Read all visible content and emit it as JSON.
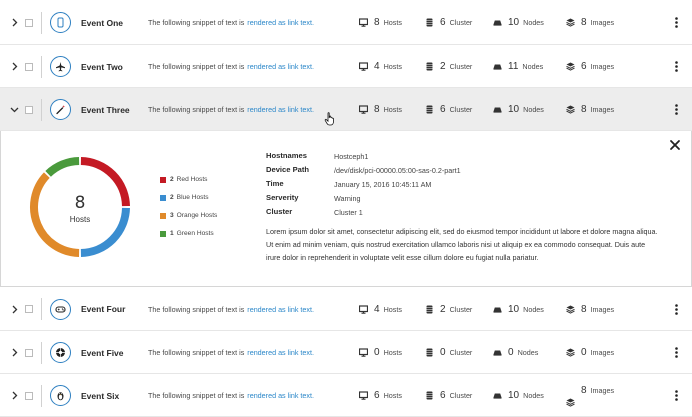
{
  "events": [
    {
      "name": "Event One",
      "icon": "server-icon",
      "desc_text": "The following snippet of text is",
      "desc_link": "rendered as link text.",
      "hosts": "8",
      "hosts_label": "Hosts",
      "cluster": "6",
      "cluster_label": "Cluster",
      "nodes": "10",
      "nodes_label": "Nodes",
      "images": "8",
      "images_label": "Images",
      "expanded": false
    },
    {
      "name": "Event Two",
      "icon": "airplane-icon",
      "desc_text": "The following snippet of text is",
      "desc_link": "rendered as link text.",
      "hosts": "4",
      "hosts_label": "Hosts",
      "cluster": "2",
      "cluster_label": "Cluster",
      "nodes": "11",
      "nodes_label": "Nodes",
      "images": "6",
      "images_label": "Images",
      "expanded": false
    },
    {
      "name": "Event Three",
      "icon": "magic-wand-icon",
      "desc_text": "The following snippet of text is",
      "desc_link": "rendered as link text.",
      "hosts": "8",
      "hosts_label": "Hosts",
      "cluster": "6",
      "cluster_label": "Cluster",
      "nodes": "10",
      "nodes_label": "Nodes",
      "images": "8",
      "images_label": "Images",
      "expanded": true
    },
    {
      "name": "Event Four",
      "icon": "gamepad-icon",
      "desc_text": "The following snippet of text is",
      "desc_link": "rendered as link text.",
      "hosts": "4",
      "hosts_label": "Hosts",
      "cluster": "2",
      "cluster_label": "Cluster",
      "nodes": "10",
      "nodes_label": "Nodes",
      "images": "8",
      "images_label": "Images",
      "expanded": false
    },
    {
      "name": "Event Five",
      "icon": "empire-icon",
      "desc_text": "The following snippet of text is",
      "desc_link": "rendered as link text.",
      "hosts": "0",
      "hosts_label": "Hosts",
      "cluster": "0",
      "cluster_label": "Cluster",
      "nodes": "0",
      "nodes_label": "Nodes",
      "images": "0",
      "images_label": "Images",
      "expanded": false
    },
    {
      "name": "Event Six",
      "icon": "linux-icon",
      "desc_text": "The following snippet of text is",
      "desc_link": "rendered as link text.",
      "hosts": "6",
      "hosts_label": "Hosts",
      "cluster": "6",
      "cluster_label": "Cluster",
      "nodes": "10",
      "nodes_label": "Nodes",
      "images": "8",
      "images_label": "Images",
      "expanded": false
    }
  ],
  "detail": {
    "donut": {
      "total": "8",
      "label": "Hosts",
      "segments": [
        {
          "count": "2",
          "name": "Red Hosts",
          "value": 2,
          "color": "#c41a24"
        },
        {
          "count": "2",
          "name": "Blue Hosts",
          "value": 2,
          "color": "#3a8dd0"
        },
        {
          "count": "3",
          "name": "Orange Hosts",
          "value": 3,
          "color": "#e08a2a"
        },
        {
          "count": "1",
          "name": "Green Hosts",
          "value": 1,
          "color": "#4a9a3c"
        }
      ]
    },
    "fields": [
      {
        "key": "Hostnames",
        "value": "Hostceph1"
      },
      {
        "key": "Device Path",
        "value": "/dev/disk/pci-00000.05:00-sas-0.2-part1"
      },
      {
        "key": "Time",
        "value": "January 15, 2016 10:45:11 AM"
      },
      {
        "key": "Serverity",
        "value": "Warning"
      },
      {
        "key": "Cluster",
        "value": "Cluster 1"
      }
    ],
    "description": "Lorem ipsum dolor sit amet, consectetur adipiscing elit, sed do eiusmod tempor incididunt ut labore et dolore magna aliqua. Ut enim ad minim veniam, quis nostrud exercitation ullamco laboris nisi ut aliquip ex ea commodo consequat. Duis aute irure dolor in reprehenderit in voluptate velit esse cillum dolore eu fugiat nulla pariatur."
  },
  "colors": {
    "accent": "#2d7fc1",
    "link": "#2b87c9",
    "expanded_row_bg": "#ededed"
  }
}
